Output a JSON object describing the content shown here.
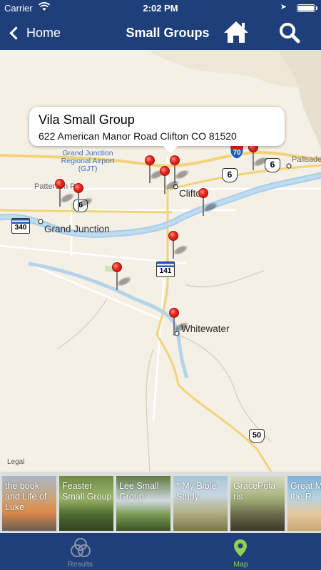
{
  "status_bar": {
    "carrier": "Carrier",
    "time": "2:02 PM"
  },
  "nav": {
    "back_label": "Home",
    "title": "Small Groups"
  },
  "map": {
    "callout": {
      "title": "Vila Small Group",
      "address": "622 American Manor Road Clifton CO 81520"
    },
    "labels": {
      "airport": "Grand Junction Regional Airport (GJT)",
      "grand_junction": "Grand Junction",
      "clifton": "Clifton",
      "whitewater": "Whitewater",
      "palisade": "Palisade",
      "patterson": "Patterson R"
    },
    "shields": {
      "i70": "70",
      "us6_a": "6",
      "us6_b": "6",
      "us6_c": "6",
      "us50": "50",
      "co340": "340",
      "co141": "141"
    },
    "legal": "Legal"
  },
  "cards": [
    {
      "text": "the book and Life of Luke"
    },
    {
      "text": "Feaster Small Group"
    },
    {
      "text": "Lee Small Group"
    },
    {
      "text": "* My Bible Study"
    },
    {
      "text": "GracePola ris"
    },
    {
      "text": "Great M of the R"
    }
  ],
  "tabs": {
    "results": "Results",
    "map": "Map"
  },
  "colors": {
    "nav_bg": "#1f3f7a",
    "pin": "#e8231a",
    "active_tab": "#8fd14f",
    "inactive_tab": "#8a95a8"
  }
}
